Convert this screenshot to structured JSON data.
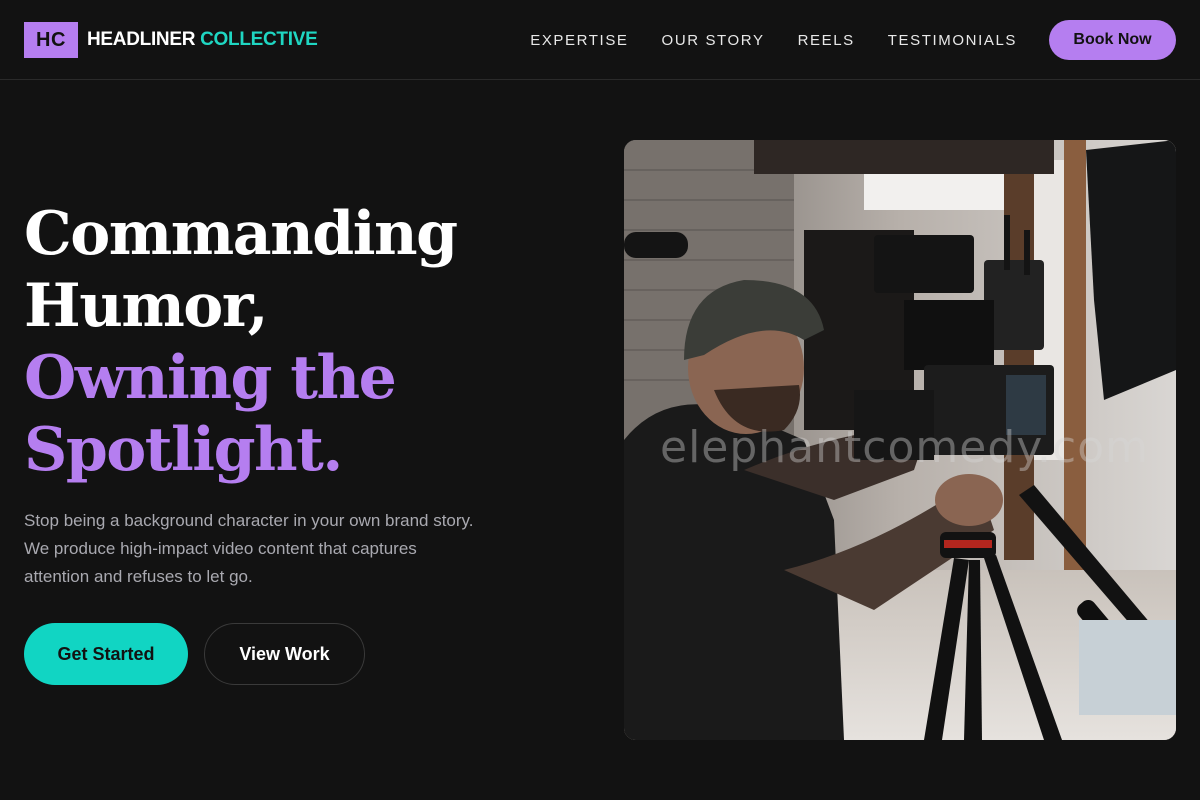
{
  "brand": {
    "mark": "HC",
    "name_part1": "HEADLINER",
    "name_part2": "COLLECTIVE",
    "colors": {
      "accent_purple": "#b57ef0",
      "accent_teal": "#11d5c3",
      "background": "#121212"
    }
  },
  "nav": {
    "items": [
      {
        "label": "EXPERTISE"
      },
      {
        "label": "OUR STORY"
      },
      {
        "label": "REELS"
      },
      {
        "label": "TESTIMONIALS"
      }
    ],
    "cta_label": "Book Now"
  },
  "hero": {
    "headline_line1": "Commanding",
    "headline_line2": "Humor,",
    "headline_line3": "Owning the",
    "headline_line4": "Spotlight.",
    "intro": "Stop being a background character in your own brand story. We produce high-impact video content that captures attention and refuses to let go.",
    "primary_label": "Get Started",
    "secondary_label": "View Work",
    "image": {
      "subject": "videographer-operating-cinema-camera-photo",
      "watermark": "elephantcomedy.com"
    }
  }
}
